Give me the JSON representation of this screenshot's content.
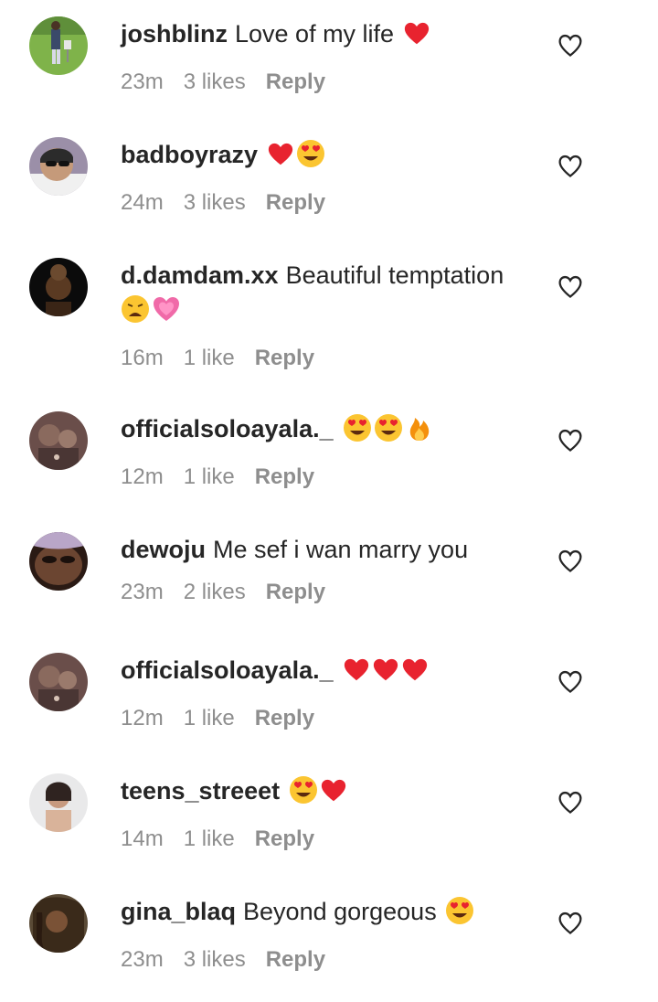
{
  "comments": [
    {
      "username": "joshblinz",
      "text": "Love of my life",
      "emoji": [
        "red-heart"
      ],
      "time": "23m",
      "likes": "3 likes",
      "reply": "Reply",
      "avatar": "avatar-lawn"
    },
    {
      "username": "badboyrazy",
      "text": "",
      "emoji": [
        "red-heart",
        "heart-eyes"
      ],
      "time": "24m",
      "likes": "3 likes",
      "reply": "Reply",
      "avatar": "avatar-sunglasses"
    },
    {
      "username": "d.damdam.xx",
      "text": "Beautiful temptation",
      "emoji": [
        "weary-face",
        "growing-heart"
      ],
      "time": "16m",
      "likes": "1 like",
      "reply": "Reply",
      "avatar": "avatar-dark"
    },
    {
      "username": "officialsoloayala._",
      "text": "",
      "emoji": [
        "heart-eyes",
        "heart-eyes",
        "fire"
      ],
      "time": "12m",
      "likes": "1 like",
      "reply": "Reply",
      "avatar": "avatar-group"
    },
    {
      "username": "dewoju",
      "text": "Me sef i wan marry you",
      "emoji": [],
      "time": "23m",
      "likes": "2 likes",
      "reply": "Reply",
      "avatar": "avatar-face"
    },
    {
      "username": "officialsoloayala._",
      "text": "",
      "emoji": [
        "red-heart",
        "red-heart",
        "red-heart"
      ],
      "time": "12m",
      "likes": "1 like",
      "reply": "Reply",
      "avatar": "avatar-group"
    },
    {
      "username": "teens_streeet",
      "text": "",
      "emoji": [
        "heart-eyes",
        "red-heart"
      ],
      "time": "14m",
      "likes": "1 like",
      "reply": "Reply",
      "avatar": "avatar-portrait"
    },
    {
      "username": "gina_blaq",
      "text": "Beyond gorgeous",
      "emoji": [
        "heart-eyes"
      ],
      "time": "23m",
      "likes": "3 likes",
      "reply": "Reply",
      "avatar": "avatar-hair"
    }
  ],
  "colors": {
    "text": "#262626",
    "meta": "#8e8e8e",
    "background": "#ffffff"
  },
  "icons": {
    "like": "heart-outline-icon"
  }
}
